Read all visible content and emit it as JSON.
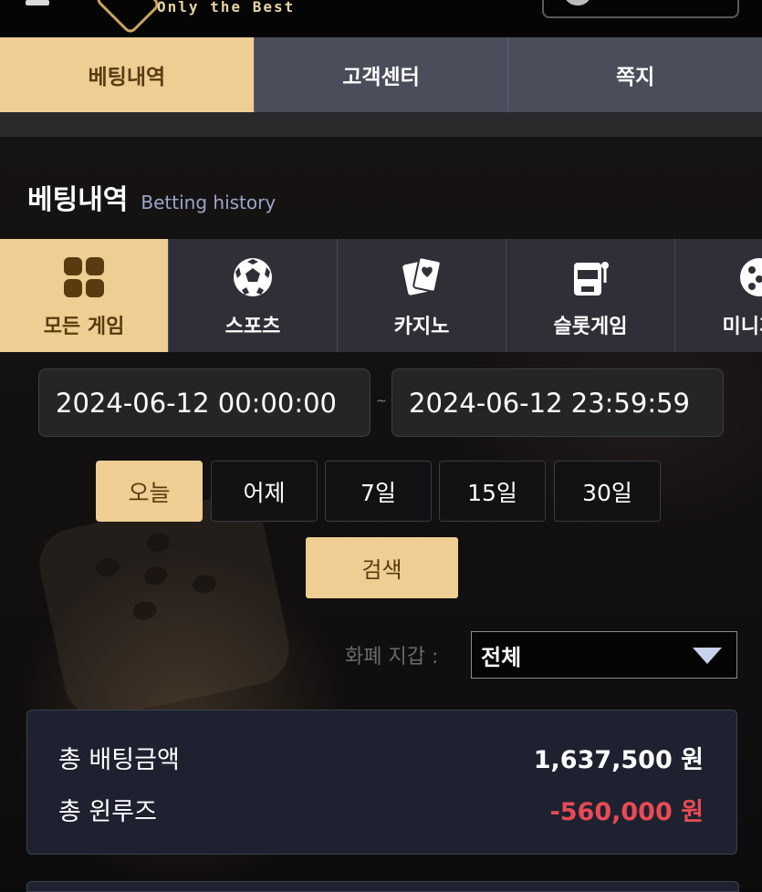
{
  "header": {
    "logo_tagline": "Only the Best"
  },
  "main_tabs": [
    {
      "label": "베팅내역",
      "active": true
    },
    {
      "label": "고객센터",
      "active": false
    },
    {
      "label": "쪽지",
      "active": false
    }
  ],
  "section": {
    "title": "베팅내역",
    "subtitle": "Betting history"
  },
  "game_tabs": [
    {
      "label": "모든 게임",
      "icon": "grid-icon",
      "active": true
    },
    {
      "label": "스포츠",
      "icon": "soccer-ball-icon",
      "active": false
    },
    {
      "label": "카지노",
      "icon": "playing-cards-icon",
      "active": false
    },
    {
      "label": "슬롯게임",
      "icon": "slot-machine-icon",
      "active": false
    },
    {
      "label": "미니게임",
      "icon": "mini-game-icon",
      "active": false
    }
  ],
  "date_range": {
    "start": "2024-06-12 00:00:00",
    "separator": "~",
    "end": "2024-06-12 23:59:59"
  },
  "quick_ranges": [
    {
      "label": "오늘",
      "active": true
    },
    {
      "label": "어제",
      "active": false
    },
    {
      "label": "7일",
      "active": false
    },
    {
      "label": "15일",
      "active": false
    },
    {
      "label": "30일",
      "active": false
    }
  ],
  "search_label": "검색",
  "wallet": {
    "label": "화폐 지갑 :",
    "selected": "전체"
  },
  "summary": {
    "total_bet_label": "총 배팅금액",
    "total_bet_value": "1,637,500 원",
    "total_win_loss_label": "총 윈루즈",
    "total_win_loss_value": "-560,000 원"
  },
  "colors": {
    "accent": "#efce93",
    "accent_text": "#5a3a0f",
    "negative": "#ea4a55",
    "tab_bg": "#4a4d5a",
    "game_tab_bg": "#2f2f38"
  }
}
